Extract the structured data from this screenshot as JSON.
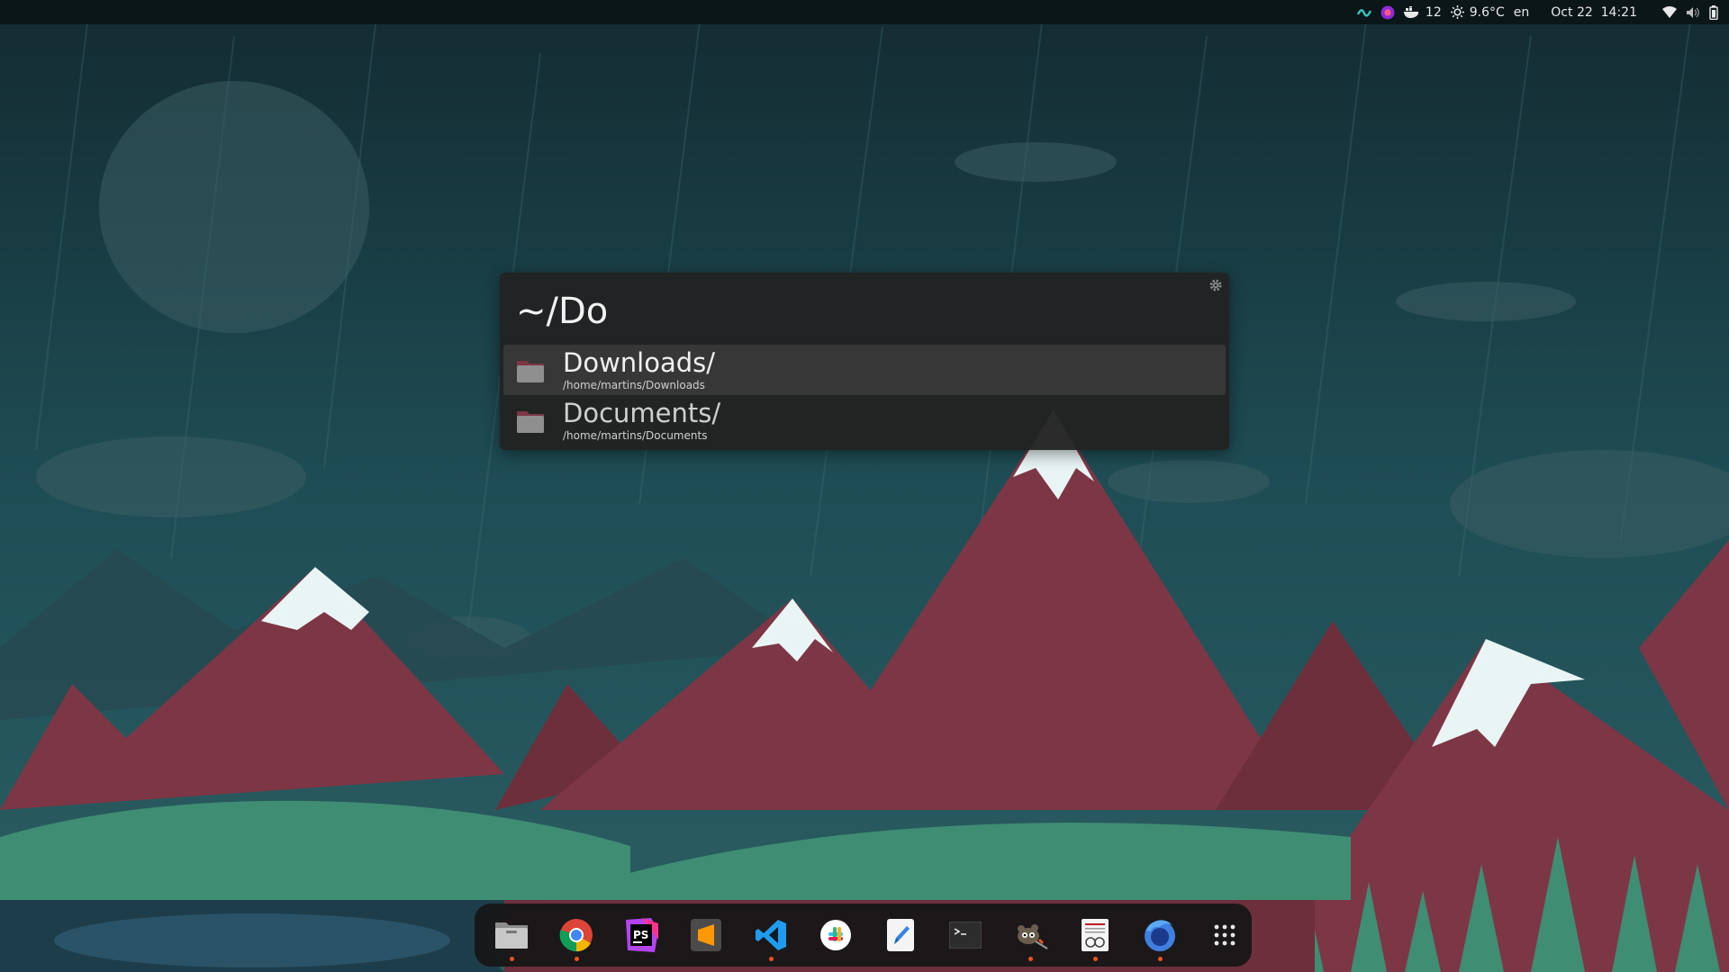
{
  "topbar": {
    "tray_count": "12",
    "weather": "9.6°C",
    "keyboard_layout": "en",
    "clock": "Oct 22  14:21"
  },
  "launcher": {
    "query": "~/Do",
    "results": [
      {
        "name": "Downloads/",
        "path": "/home/martins/Downloads",
        "selected": true
      },
      {
        "name": "Documents/",
        "path": "/home/martins/Documents",
        "selected": false
      }
    ]
  },
  "dock": {
    "apps": [
      {
        "icon": "files-icon",
        "running": true
      },
      {
        "icon": "chrome-icon",
        "running": true
      },
      {
        "icon": "phpstorm-icon",
        "running": false
      },
      {
        "icon": "sublime-text-icon",
        "running": false
      },
      {
        "icon": "vscode-icon",
        "running": true
      },
      {
        "icon": "slack-icon",
        "running": false
      },
      {
        "icon": "text-editor-icon",
        "running": false
      },
      {
        "icon": "terminal-icon",
        "running": false
      },
      {
        "icon": "gimp-icon",
        "running": true
      },
      {
        "icon": "document-viewer-icon",
        "running": true
      },
      {
        "icon": "firefox-icon",
        "running": true
      },
      {
        "icon": "show-apps-icon",
        "running": false
      }
    ]
  },
  "colors": {
    "accent_orange": "#e95420",
    "mountain": "#7d3645",
    "snow": "#e9f4f4",
    "forest_green": "#3f8e73",
    "sky": "#1f4a52"
  }
}
